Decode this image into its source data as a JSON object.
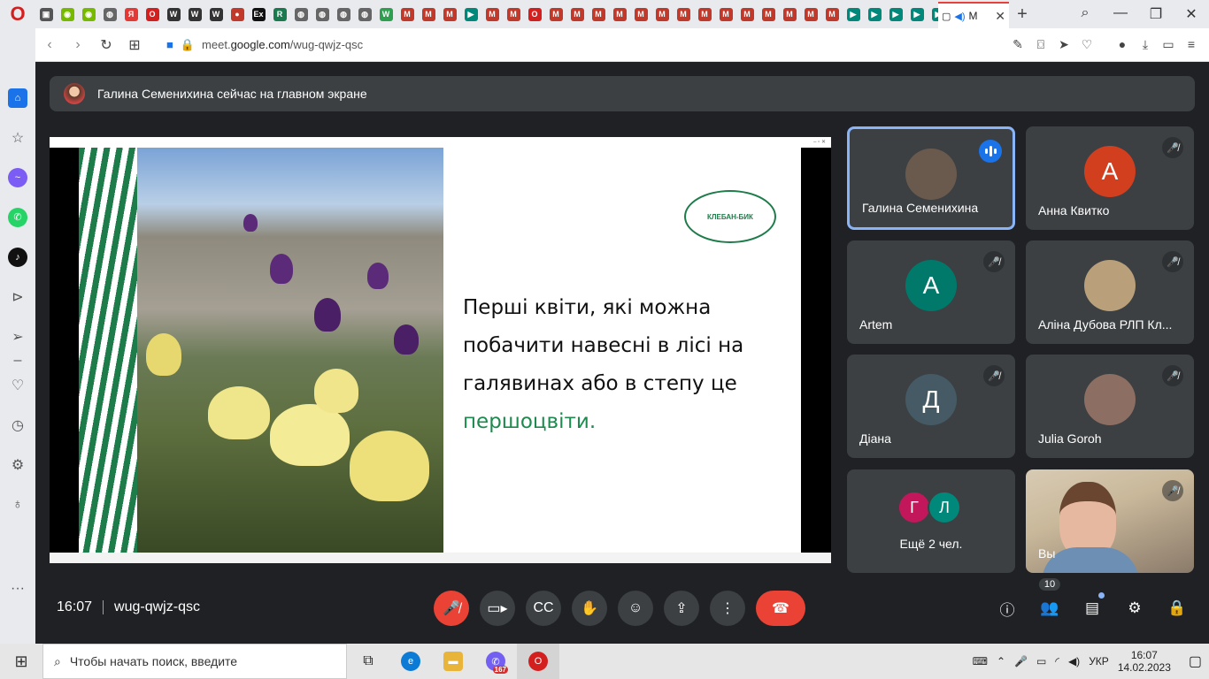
{
  "browser": {
    "active_tab_label": "M",
    "url_prefix": "meet.",
    "url_domain": "google.com",
    "url_path": "/wug-qwjz-qsc"
  },
  "tabs": [
    {
      "icon": "cube-icon",
      "color": "#555",
      "glyph": "▣"
    },
    {
      "icon": "nvidia-icon",
      "color": "#76b900",
      "glyph": "◉"
    },
    {
      "icon": "nvidia-icon",
      "color": "#76b900",
      "glyph": "◉"
    },
    {
      "icon": "globe-icon",
      "color": "#666",
      "glyph": "◍"
    },
    {
      "icon": "yandex-icon",
      "color": "#e53935",
      "glyph": "Я"
    },
    {
      "icon": "opera-icon",
      "color": "#d41f1f",
      "glyph": "O"
    },
    {
      "icon": "wiki-icon",
      "color": "#333",
      "glyph": "W"
    },
    {
      "icon": "wiki-icon",
      "color": "#333",
      "glyph": "W"
    },
    {
      "icon": "wiki-icon",
      "color": "#333",
      "glyph": "W"
    },
    {
      "icon": "chat-icon",
      "color": "#c0392b",
      "glyph": "●"
    },
    {
      "icon": "ex-icon",
      "color": "#111",
      "glyph": "Ex"
    },
    {
      "icon": "r-icon",
      "color": "#1b7a4d",
      "glyph": "R"
    },
    {
      "icon": "globe-icon",
      "color": "#666",
      "glyph": "◍"
    },
    {
      "icon": "globe-icon",
      "color": "#666",
      "glyph": "◍"
    },
    {
      "icon": "globe-icon",
      "color": "#666",
      "glyph": "◍"
    },
    {
      "icon": "globe-icon",
      "color": "#666",
      "glyph": "◍"
    },
    {
      "icon": "wiki-green-icon",
      "color": "#2e9e4f",
      "glyph": "W"
    },
    {
      "icon": "mail-icon",
      "color": "#c0392b",
      "glyph": "M"
    },
    {
      "icon": "mail-icon",
      "color": "#c0392b",
      "glyph": "M"
    },
    {
      "icon": "mail-icon",
      "color": "#c0392b",
      "glyph": "M"
    },
    {
      "icon": "meet-icon",
      "color": "#00897b",
      "glyph": "▶"
    },
    {
      "icon": "mail-icon",
      "color": "#c0392b",
      "glyph": "M"
    },
    {
      "icon": "mail-icon",
      "color": "#c0392b",
      "glyph": "M"
    },
    {
      "icon": "opera-icon",
      "color": "#d41f1f",
      "glyph": "O"
    },
    {
      "icon": "mail-icon",
      "color": "#c0392b",
      "glyph": "M"
    },
    {
      "icon": "mail-icon",
      "color": "#c0392b",
      "glyph": "M"
    },
    {
      "icon": "mail-icon",
      "color": "#c0392b",
      "glyph": "M"
    },
    {
      "icon": "mail-icon",
      "color": "#c0392b",
      "glyph": "M"
    },
    {
      "icon": "mail-icon",
      "color": "#c0392b",
      "glyph": "M"
    },
    {
      "icon": "mail-icon",
      "color": "#c0392b",
      "glyph": "M"
    },
    {
      "icon": "mail-icon",
      "color": "#c0392b",
      "glyph": "M"
    },
    {
      "icon": "mail-icon",
      "color": "#c0392b",
      "glyph": "M"
    },
    {
      "icon": "mail-icon",
      "color": "#c0392b",
      "glyph": "M"
    },
    {
      "icon": "mail-icon",
      "color": "#c0392b",
      "glyph": "M"
    },
    {
      "icon": "mail-icon",
      "color": "#c0392b",
      "glyph": "M"
    },
    {
      "icon": "mail-icon",
      "color": "#c0392b",
      "glyph": "M"
    },
    {
      "icon": "mail-icon",
      "color": "#c0392b",
      "glyph": "M"
    },
    {
      "icon": "mail-icon",
      "color": "#c0392b",
      "glyph": "M"
    },
    {
      "icon": "meet-icon",
      "color": "#00897b",
      "glyph": "▶"
    },
    {
      "icon": "meet-icon",
      "color": "#00897b",
      "glyph": "▶"
    },
    {
      "icon": "meet-icon",
      "color": "#00897b",
      "glyph": "▶"
    },
    {
      "icon": "meet-icon",
      "color": "#00897b",
      "glyph": "▶"
    },
    {
      "icon": "meet-icon",
      "color": "#00897b",
      "glyph": "▶"
    }
  ],
  "meet": {
    "banner_text": "Галина Семенихина сейчас на главном экране",
    "slide": {
      "text_main": "Перші квіти, які можна побачити навесні в лісі на галявинах або в степу це",
      "text_accent": "першоцвіти.",
      "logo_text": "КЛЕБАН-БИК"
    },
    "participants": [
      {
        "name": "Галина Семенихина",
        "initial": "",
        "color": "#6a5a4e",
        "state": "speaking"
      },
      {
        "name": "Анна Квитко",
        "initial": "А",
        "color": "#d23f1f",
        "state": "muted"
      },
      {
        "name": "Artem",
        "initial": "A",
        "color": "#00796b",
        "state": "muted"
      },
      {
        "name": "Аліна Дубова РЛП Кл...",
        "initial": "",
        "color": "#b9a07a",
        "state": "muted"
      },
      {
        "name": "Діана",
        "initial": "Д",
        "color": "#455a64",
        "state": "muted"
      },
      {
        "name": "Julia Goroh",
        "initial": "",
        "color": "#8d6e63",
        "state": "muted"
      }
    ],
    "others": {
      "initials": [
        "Г",
        "Л"
      ],
      "colors": [
        "#c2185b",
        "#00897b"
      ],
      "label": "Ещё 2 чел."
    },
    "self_label": "Вы",
    "time": "16:07",
    "meeting_code": "wug-qwjz-qsc",
    "people_count": "10"
  },
  "taskbar": {
    "search_placeholder": "Чтобы начать поиск, введите",
    "language": "УКР",
    "time": "16:07",
    "date": "14.02.2023",
    "viber_badge": "167"
  }
}
